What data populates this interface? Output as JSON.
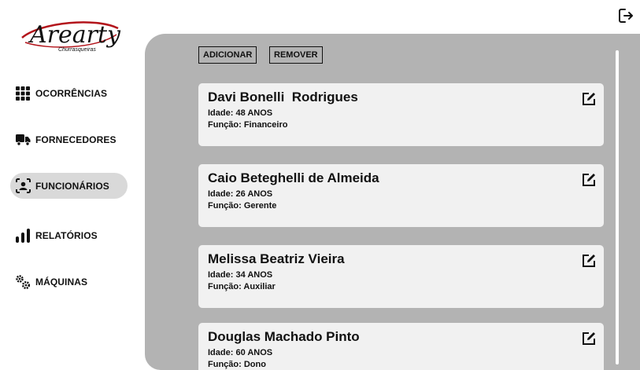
{
  "brand": {
    "logo_text": "Arearty",
    "logo_subtext": "Churrasqueiras",
    "logo_color": "#b3141b"
  },
  "header": {
    "logout_icon": "logout-icon"
  },
  "sidebar": {
    "items": [
      {
        "label": "OCORRÊNCIAS",
        "icon": "grid-icon",
        "active": false
      },
      {
        "label": "FORNECEDORES",
        "icon": "truck-icon",
        "active": false
      },
      {
        "label": "FUNCIONÁRIOS",
        "icon": "employee-scan-icon",
        "active": true
      },
      {
        "label": "RELATÓRIOS",
        "icon": "bar-chart-icon",
        "active": false
      },
      {
        "label": "MÁQUINAS",
        "icon": "gears-icon",
        "active": false
      }
    ],
    "active_bg": "#d9d9d9"
  },
  "toolbar": {
    "add_label": "ADICIONAR",
    "remove_label": "REMOVER"
  },
  "employees": [
    {
      "name": "Davi Bonelli  Rodrigues",
      "age": "Idade: 48 ANOS",
      "role": "Função: Financeiro"
    },
    {
      "name": "Caio Beteghelli de Almeida",
      "age": "Idade: 26 ANOS",
      "role": "Função: Gerente"
    },
    {
      "name": "Melissa Beatriz Vieira",
      "age": "Idade: 34 ANOS",
      "role": "Função: Auxiliar"
    },
    {
      "name": "Douglas Machado Pinto",
      "age": "Idade: 60 ANOS",
      "role": "Função: Dono"
    }
  ],
  "colors": {
    "panel_bg": "#b3b3b3",
    "card_bg": "#f1f1f1"
  }
}
